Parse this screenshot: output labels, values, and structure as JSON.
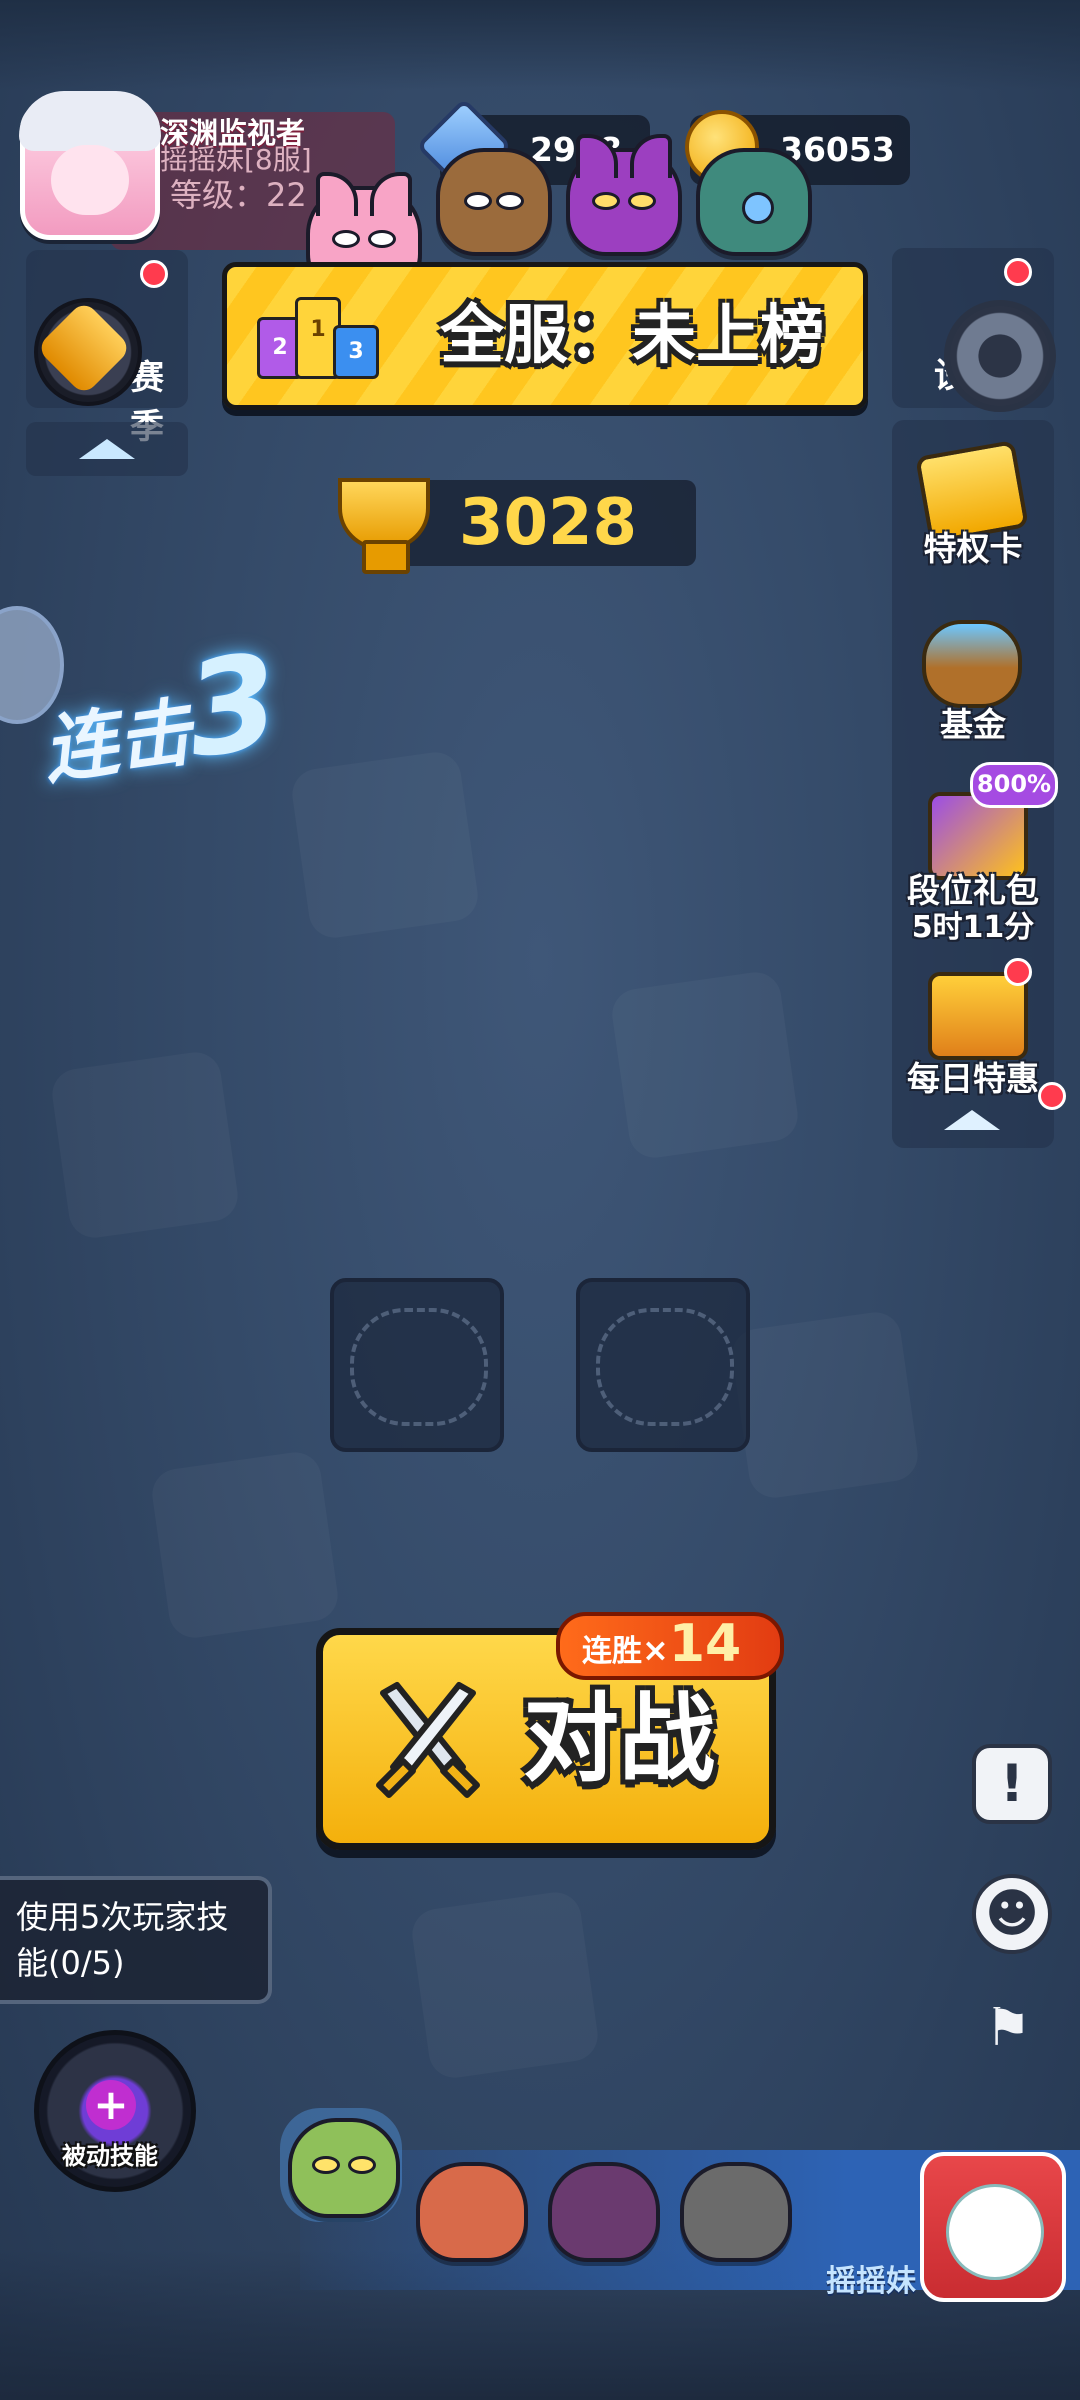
{
  "profile": {
    "name": "深渊监视者",
    "server": "摇摇妹[8服]",
    "level": "等级：22"
  },
  "currencies": {
    "gems": "2978",
    "gold": "36053"
  },
  "left_panel": {
    "label": "赛季"
  },
  "rank": {
    "text": "全服：未上榜",
    "podium": [
      "2",
      "1",
      "3"
    ]
  },
  "trophies": "3028",
  "right_panel": {
    "top_label": "设",
    "items": [
      {
        "label": "特权卡"
      },
      {
        "label": "基金"
      },
      {
        "label": "段位礼包",
        "timer": "5时11分",
        "badge": "800%"
      },
      {
        "label": "每日特惠"
      }
    ]
  },
  "combo": {
    "text": "连击",
    "count": "3"
  },
  "battle": {
    "label": "对战",
    "streak_label": "连胜",
    "streak_x": "×",
    "streak_count": "14"
  },
  "task": {
    "text": "使用5次玩家技能(0/5)"
  },
  "skill": {
    "label": "被动技能",
    "plus": "+"
  },
  "right_bottom": {
    "alert_glyph": "!",
    "emote_glyph": "☻",
    "flag_glyph": "⚑"
  },
  "bottom": {
    "player_name": "摇摇妹"
  },
  "colors": {
    "accent_yellow": "#ffd43a",
    "trophy_gold": "#ffd74a",
    "notify_red": "#ff3b4e",
    "bar_blue": "#2d63b5"
  }
}
